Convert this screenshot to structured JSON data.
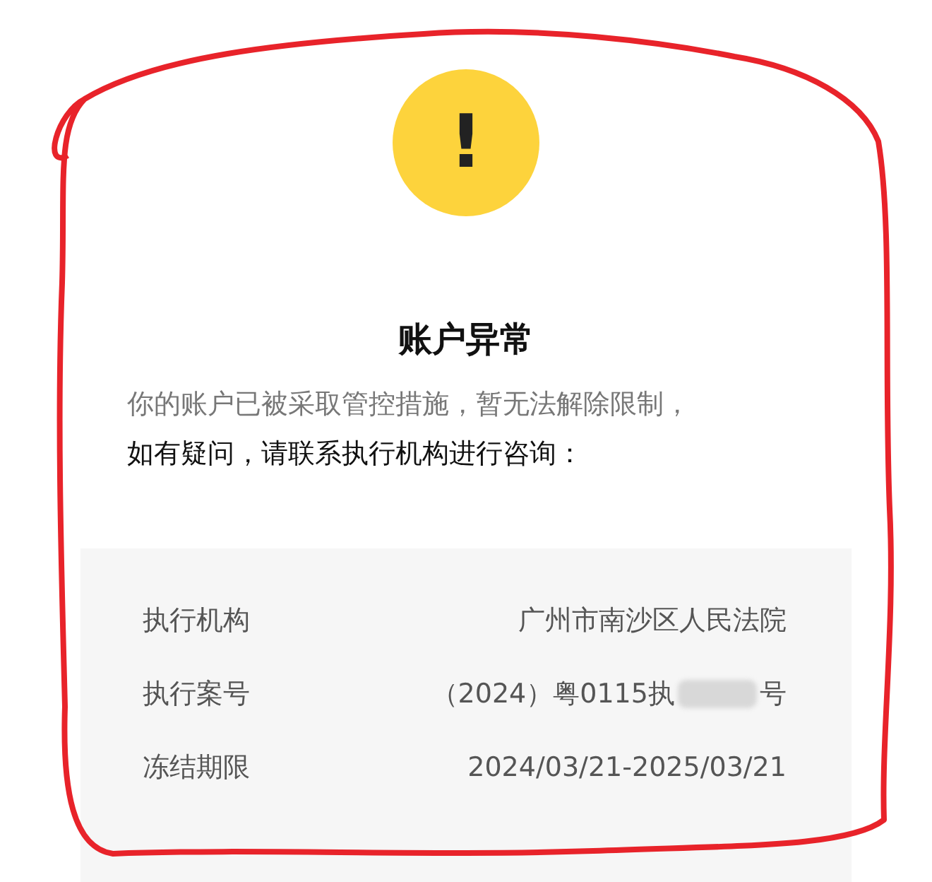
{
  "alert_icon": {
    "symbol": "!"
  },
  "title": "账户异常",
  "message_lines": [
    {
      "text": "你的账户已被采取管控措施，暂无法解除限制，",
      "kind": "muted"
    },
    {
      "text": "如有疑问，请联系执行机构进行咨询：",
      "kind": "strong"
    }
  ],
  "details": [
    {
      "label": "执行机构",
      "value": "广州市南沙区人民法院",
      "kind": "plain"
    },
    {
      "label": "执行案号",
      "value": "（2024）粤0115执",
      "value_suffix": "号",
      "kind": "redacted"
    },
    {
      "label": "冻结期限",
      "value": "2024/03/21-2025/03/21",
      "kind": "plain"
    }
  ]
}
